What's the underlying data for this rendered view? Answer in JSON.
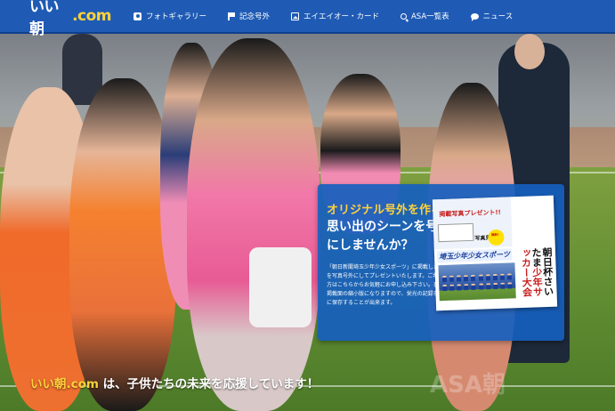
{
  "header": {
    "logo_main": "いい朝",
    "logo_suffix": ".com",
    "nav": [
      {
        "label": "フォトギャラリー",
        "icon": "camera-icon"
      },
      {
        "label": "記念号外",
        "icon": "flag-icon"
      },
      {
        "label": "エイエイオー・カード",
        "icon": "image-icon"
      },
      {
        "label": "ASA一覧表",
        "icon": "search-icon"
      },
      {
        "label": "ニュース",
        "icon": "chat-icon"
      }
    ]
  },
  "promo": {
    "headline": "オリジナル号外を作ろう！",
    "subhead": "思い出のシーンを号外にしませんか？",
    "body": "「朝日新聞埼玉少年少女スポーツ」に掲載した写真を写真号外にしてプレゼントいたします。ご希望の方はこちらからお気軽にお申し込み下さい。裏面は掲載面の縮小版になりますので、栄光の記録を大切に保存することが出来ます。",
    "paper": {
      "title": "掲載写真プレゼント!!",
      "sample_label": "写真見本",
      "badge": "無料！",
      "sports_title": "埼玉少年少女スポーツ",
      "vertical_black": "朝日杯さいたま",
      "vertical_red": "少年サッカー大会"
    }
  },
  "slogan": {
    "brand": "いい朝.com",
    "text": " は、子供たちの未来を応援しています！"
  },
  "watermark": "ASA朝"
}
